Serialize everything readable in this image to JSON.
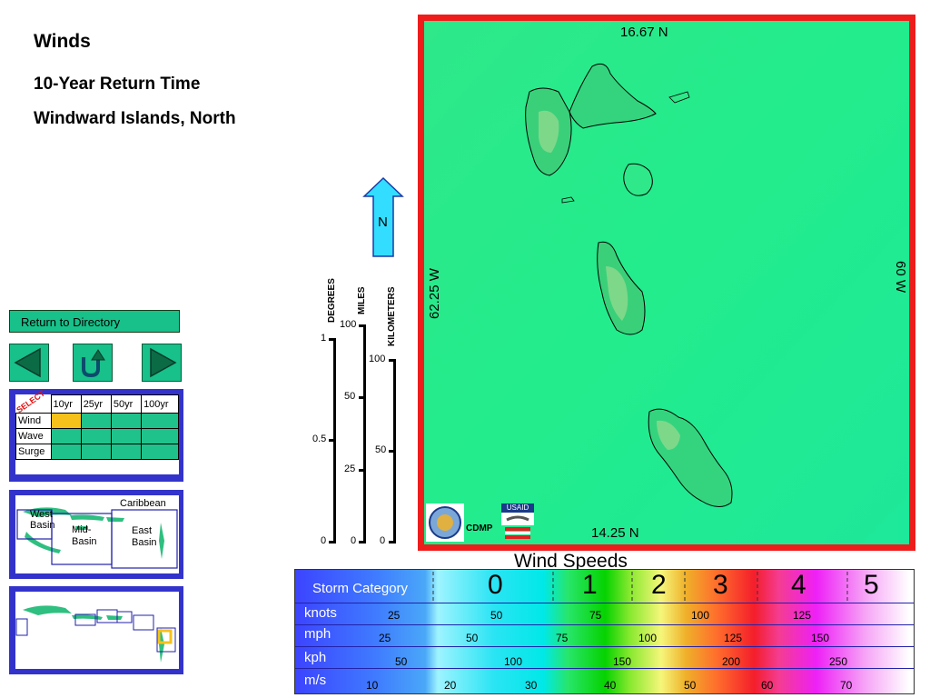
{
  "header": {
    "title": "Winds",
    "subtitle1": "10-Year Return Time",
    "subtitle2": "Windward Islands, North"
  },
  "nav": {
    "return_label": "Return to Directory",
    "prev_icon": "left-triangle-icon",
    "home_icon": "u-turn-arrow-icon",
    "next_icon": "right-triangle-icon"
  },
  "selector": {
    "select_label": "SELECT",
    "columns": [
      "10yr",
      "25yr",
      "50yr",
      "100yr"
    ],
    "rows": [
      "Wind",
      "Wave",
      "Surge"
    ],
    "selected": {
      "row": "Wind",
      "col": "10yr"
    },
    "selected_color": "#f5c11a",
    "cell_color": "#20c28c"
  },
  "region_map": {
    "labels": {
      "caribbean": "Caribbean",
      "west_basin": "West Basin",
      "mid_basin": "Mid-Basin",
      "east_basin": "East Basin"
    }
  },
  "scales": {
    "degrees_label": "DEGREES",
    "miles_label": "MILES",
    "km_label": "KILOMETERS",
    "degrees_ticks": [
      "1",
      "0.5",
      "0"
    ],
    "miles_ticks": [
      "100",
      "50",
      "25",
      "0"
    ],
    "km_ticks": [
      "100",
      "50",
      "0"
    ]
  },
  "north_arrow": {
    "label": "N"
  },
  "map": {
    "top_coord": "16.67 N",
    "bottom_coord": "14.25 N",
    "left_coord": "62.25 W",
    "right_coord": "60 W",
    "frame_color": "#ef1c1c",
    "sea_color": "#22ee88",
    "cdmp_label": "CDMP",
    "usaid_label": "USAID"
  },
  "legend": {
    "title": "Wind Speeds",
    "storm_category_label": "Storm Category",
    "categories": [
      "0",
      "1",
      "2",
      "3",
      "4",
      "5"
    ],
    "rows": [
      {
        "label": "knots",
        "values": [
          "25",
          "50",
          "75",
          "100",
          "125"
        ]
      },
      {
        "label": "mph",
        "values": [
          "25",
          "50",
          "75",
          "100",
          "125",
          "150"
        ]
      },
      {
        "label": "kph",
        "values": [
          "50",
          "100",
          "150",
          "200",
          "250"
        ]
      },
      {
        "label": "m/s",
        "values": [
          "10",
          "20",
          "30",
          "40",
          "50",
          "60",
          "70"
        ]
      }
    ]
  }
}
